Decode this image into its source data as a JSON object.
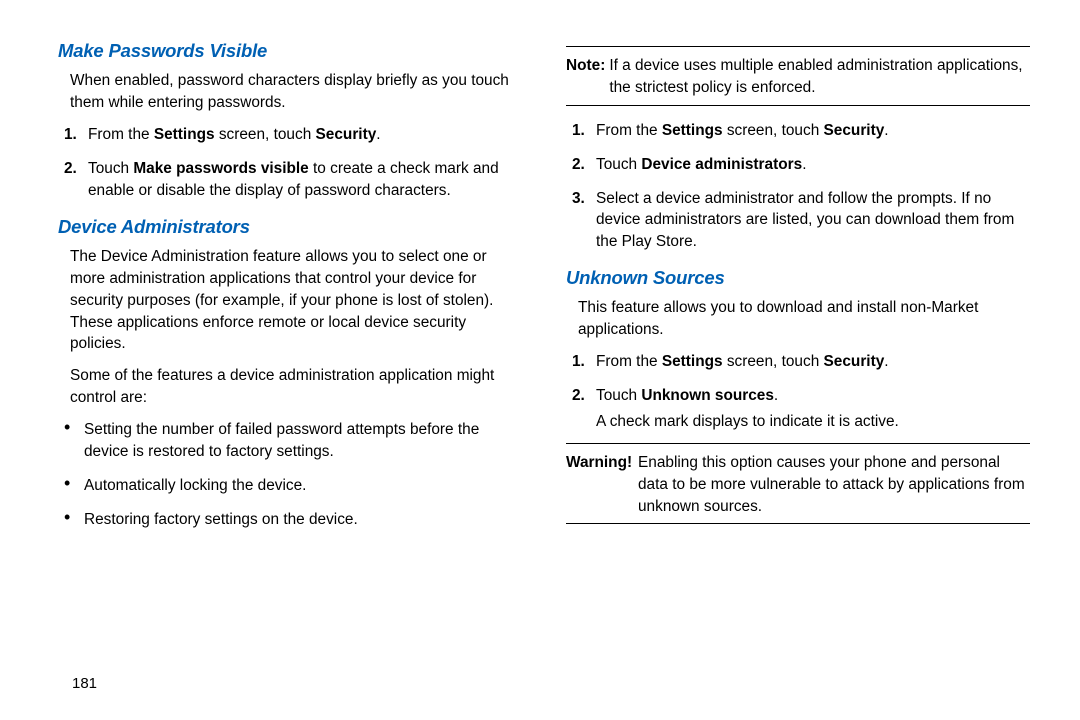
{
  "pageNumber": "181",
  "left": {
    "sec1": {
      "heading": "Make Passwords Visible",
      "intro": "When enabled, password characters display briefly as you touch them while entering passwords.",
      "step1_pre": "From the ",
      "step1_b1": "Settings",
      "step1_mid": " screen, touch ",
      "step1_b2": "Security",
      "step1_post": ".",
      "step2_pre": "Touch ",
      "step2_b": "Make passwords visible",
      "step2_post": " to create a check mark and enable or disable the display of password characters.",
      "n1": "1.",
      "n2": "2."
    },
    "sec2": {
      "heading": "Device Administrators",
      "p1": "The Device Administration feature allows you to select one or more administration applications that control your device for security purposes (for example, if your phone is lost of stolen). These applications enforce remote or local device security policies.",
      "p2": "Some of the features a device administration application might control are:",
      "b1": "Setting the number of failed password attempts before the device is restored to factory settings.",
      "b2": "Automatically locking the device.",
      "b3": "Restoring factory settings on the device."
    }
  },
  "right": {
    "note": {
      "label": "Note:",
      "body": "If a device uses multiple enabled administration applications, the strictest policy is enforced."
    },
    "steps": {
      "n1": "1.",
      "n2": "2.",
      "n3": "3.",
      "s1_pre": "From the ",
      "s1_b1": "Settings",
      "s1_mid": " screen, touch ",
      "s1_b2": "Security",
      "s1_post": ".",
      "s2_pre": "Touch ",
      "s2_b": "Device administrators",
      "s2_post": ".",
      "s3": "Select a device administrator and follow the prompts. If no device administrators are listed, you can download them from the Play Store."
    },
    "sec3": {
      "heading": "Unknown Sources",
      "intro": "This feature allows you to download and install non-Market applications.",
      "n1": "1.",
      "n2": "2.",
      "s1_pre": "From the ",
      "s1_b1": "Settings",
      "s1_mid": " screen, touch ",
      "s1_b2": "Security",
      "s1_post": ".",
      "s2_pre": "Touch ",
      "s2_b": "Unknown sources",
      "s2_post": ".",
      "after": "A check mark displays to indicate it is active."
    },
    "warn": {
      "label": "Warning!",
      "body": "Enabling this option causes your phone and personal data to be more vulnerable to attack by applications from unknown sources."
    }
  }
}
